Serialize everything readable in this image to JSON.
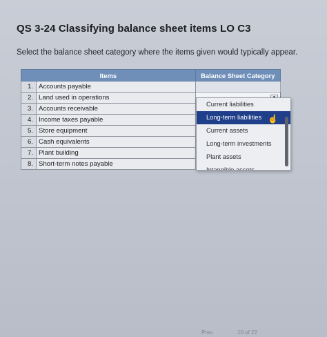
{
  "header": {
    "title": "QS 3-24 Classifying balance sheet items LO C3",
    "instruction": "Select the balance sheet category where the items given would typically appear."
  },
  "table": {
    "columns": [
      "Items",
      "Balance Sheet Category"
    ],
    "rows": [
      {
        "num": "1.",
        "item": "Accounts payable",
        "category": ""
      },
      {
        "num": "2.",
        "item": "Land used in operations",
        "category": ""
      },
      {
        "num": "3.",
        "item": "Accounts receivable",
        "category": ""
      },
      {
        "num": "4.",
        "item": "Income taxes payable",
        "category": ""
      },
      {
        "num": "5.",
        "item": "Store equipment",
        "category": ""
      },
      {
        "num": "6.",
        "item": "Cash equivalents",
        "category": ""
      },
      {
        "num": "7.",
        "item": "Plant building",
        "category": ""
      },
      {
        "num": "8.",
        "item": "Short-term notes payable",
        "category": ""
      }
    ]
  },
  "dropdown": {
    "options": [
      "Current liabilities",
      "Long-term liabilities",
      "Current assets",
      "Long-term investments",
      "Plant assets",
      "Intangible assets"
    ],
    "highlighted": "Long-term liabilities"
  },
  "footer": {
    "prev": "Prev",
    "page": "10 of 22"
  }
}
